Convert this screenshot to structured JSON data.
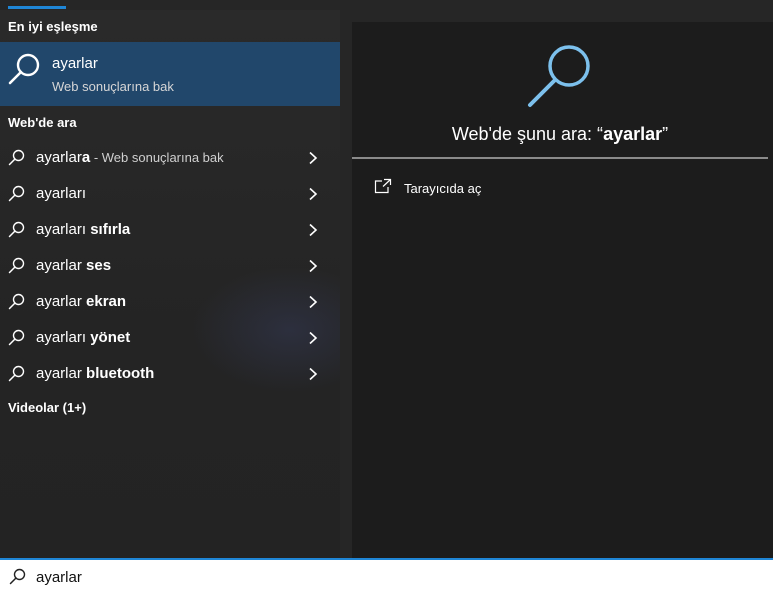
{
  "left": {
    "best_match_header": "En iyi eşleşme",
    "best_match": {
      "title": "ayarlar",
      "subtitle": "Web sonuçlarına bak"
    },
    "web_header": "Web'de ara",
    "suggestions": [
      {
        "prefix": "ayarlar",
        "bold": "a",
        "muted": " - Web sonuçlarına bak"
      },
      {
        "prefix": "ayarları",
        "bold": "",
        "muted": ""
      },
      {
        "prefix": "ayarları ",
        "bold": "sıfırla",
        "muted": ""
      },
      {
        "prefix": "ayarlar ",
        "bold": "ses",
        "muted": ""
      },
      {
        "prefix": "ayarlar ",
        "bold": "ekran",
        "muted": ""
      },
      {
        "prefix": "ayarları ",
        "bold": "yönet",
        "muted": ""
      },
      {
        "prefix": "ayarlar ",
        "bold": "bluetooth",
        "muted": ""
      }
    ],
    "videos_header": "Videolar (1+)"
  },
  "right": {
    "heading_prefix": "Web'de şunu ara: “",
    "heading_query": "ayarlar",
    "heading_suffix": "”",
    "open_in_browser": "Tarayıcıda aç"
  },
  "search": {
    "value": "ayarlar"
  },
  "colors": {
    "accent": "#1f86d6",
    "selected_bg": "#21476b",
    "icon_blue": "#7cc0ec"
  },
  "icons": {
    "search": "search-icon",
    "chevron": "chevron-right-icon",
    "open": "open-in-new-icon"
  }
}
